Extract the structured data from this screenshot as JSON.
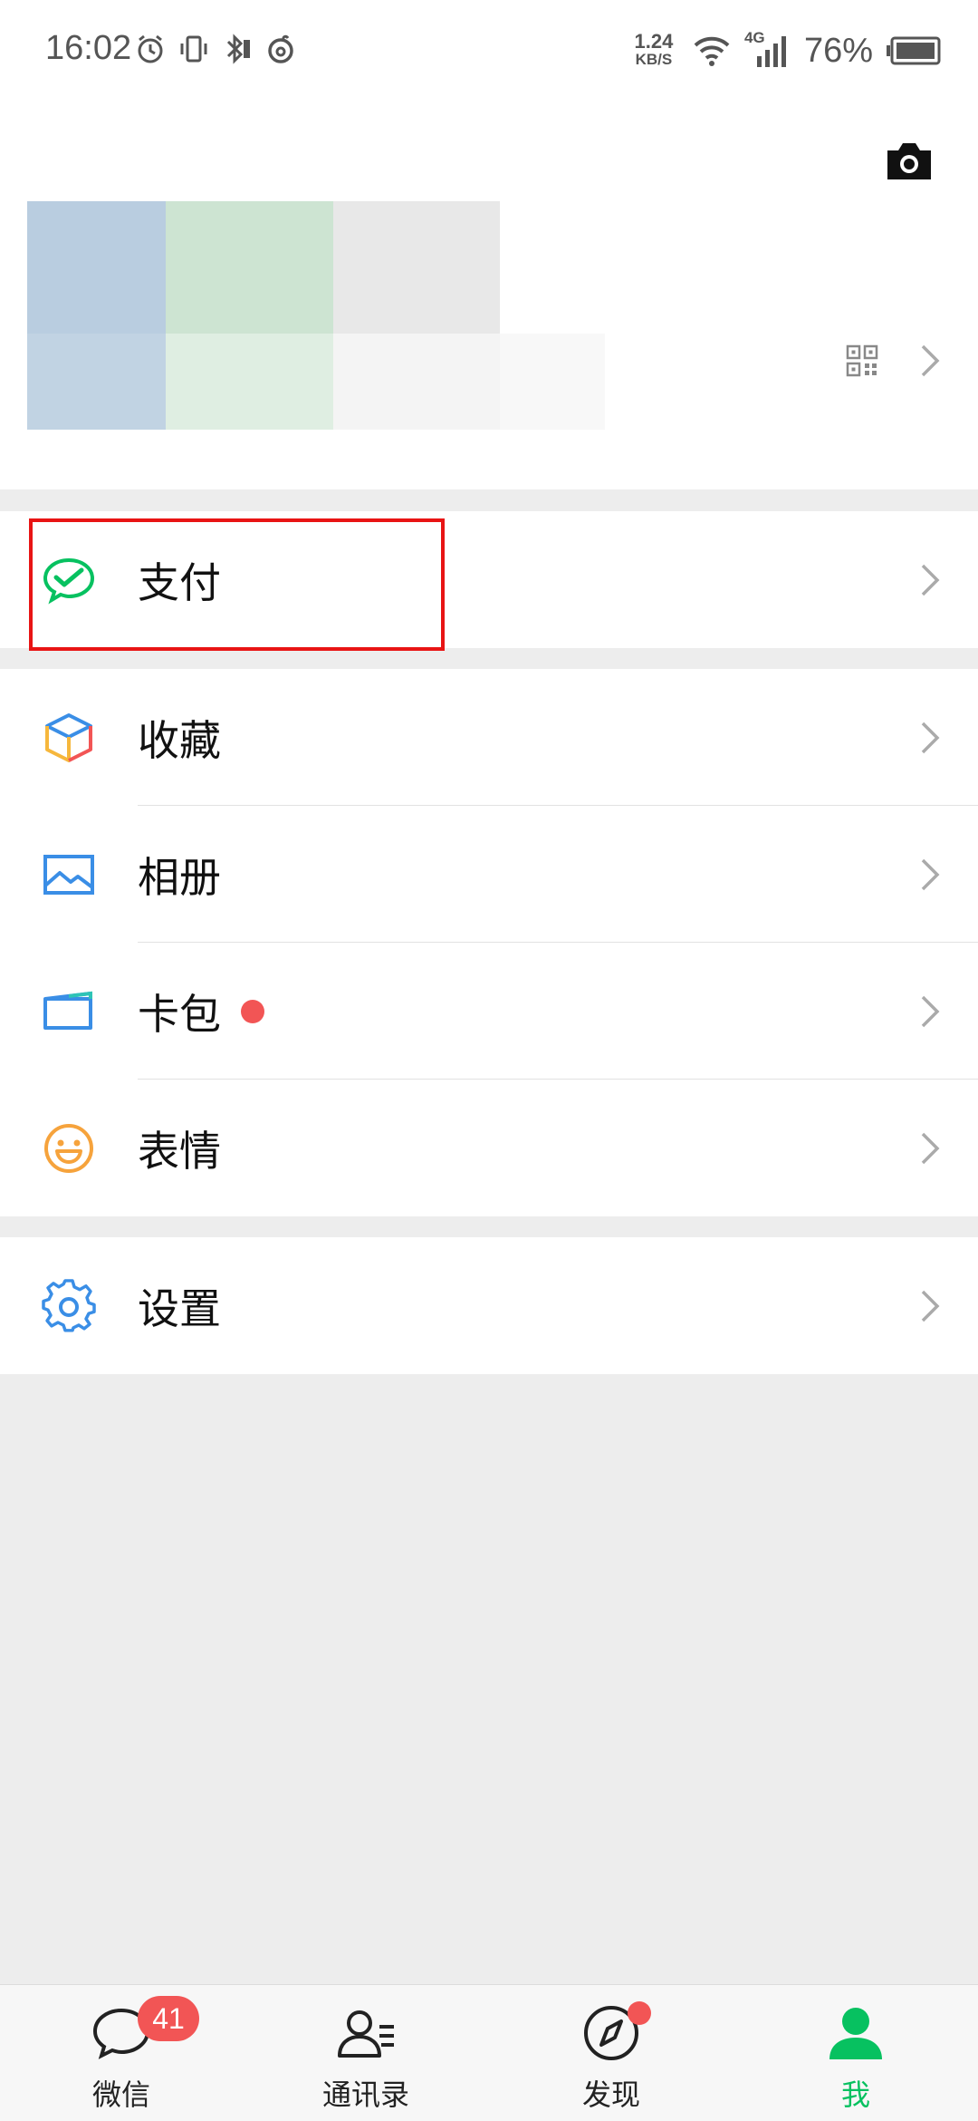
{
  "status_bar": {
    "time": "16:02",
    "net_speed_value": "1.24",
    "net_speed_unit": "KB/S",
    "network_type": "4G",
    "battery_percent": "76%",
    "icons": [
      "alarm-icon",
      "vibrate-icon",
      "bluetooth-icon",
      "netease-music-icon",
      "wifi-icon",
      "signal-icon",
      "battery-icon"
    ]
  },
  "profile": {
    "camera_icon": "camera-icon",
    "qr_icon": "qr-code-icon"
  },
  "menu": {
    "pay": {
      "label": "支付",
      "icon": "wechat-pay-icon"
    },
    "favorites": {
      "label": "收藏",
      "icon": "favorites-cube-icon"
    },
    "album": {
      "label": "相册",
      "icon": "album-picture-icon"
    },
    "cards": {
      "label": "卡包",
      "icon": "card-wallet-icon",
      "has_dot": true
    },
    "stickers": {
      "label": "表情",
      "icon": "smiley-icon"
    },
    "settings": {
      "label": "设置",
      "icon": "gear-icon"
    }
  },
  "bottom_nav": {
    "tabs": [
      {
        "label": "微信",
        "icon": "chat-bubble-icon",
        "badge": "41"
      },
      {
        "label": "通讯录",
        "icon": "contacts-icon"
      },
      {
        "label": "发现",
        "icon": "compass-icon",
        "dot": true
      },
      {
        "label": "我",
        "icon": "person-icon",
        "active": true
      }
    ]
  },
  "colors": {
    "accent_green": "#07c160",
    "badge_red": "#f25555",
    "highlight_red": "#e81414",
    "background": "#ededed"
  }
}
